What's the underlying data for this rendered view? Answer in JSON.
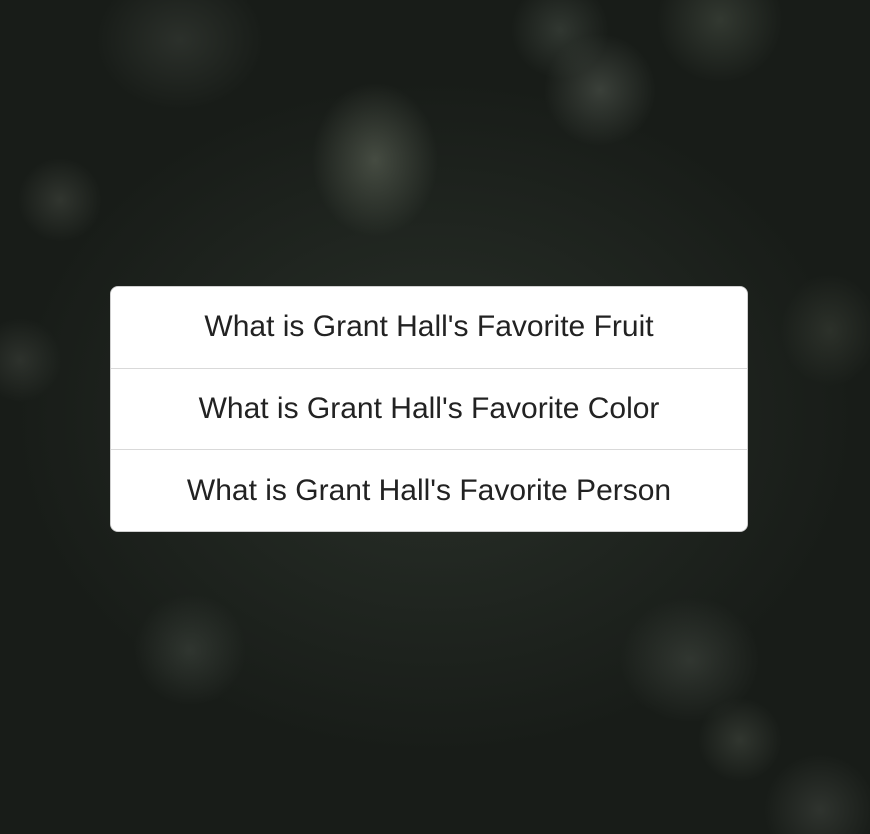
{
  "menu": {
    "items": [
      {
        "label": "What is Grant Hall's Favorite Fruit"
      },
      {
        "label": "What is Grant Hall's Favorite Color"
      },
      {
        "label": "What is Grant Hall's Favorite Person"
      }
    ]
  },
  "colors": {
    "card_background": "#ffffff",
    "text": "#222222",
    "divider": "#d9d9d9",
    "backdrop": "#1f241f"
  }
}
